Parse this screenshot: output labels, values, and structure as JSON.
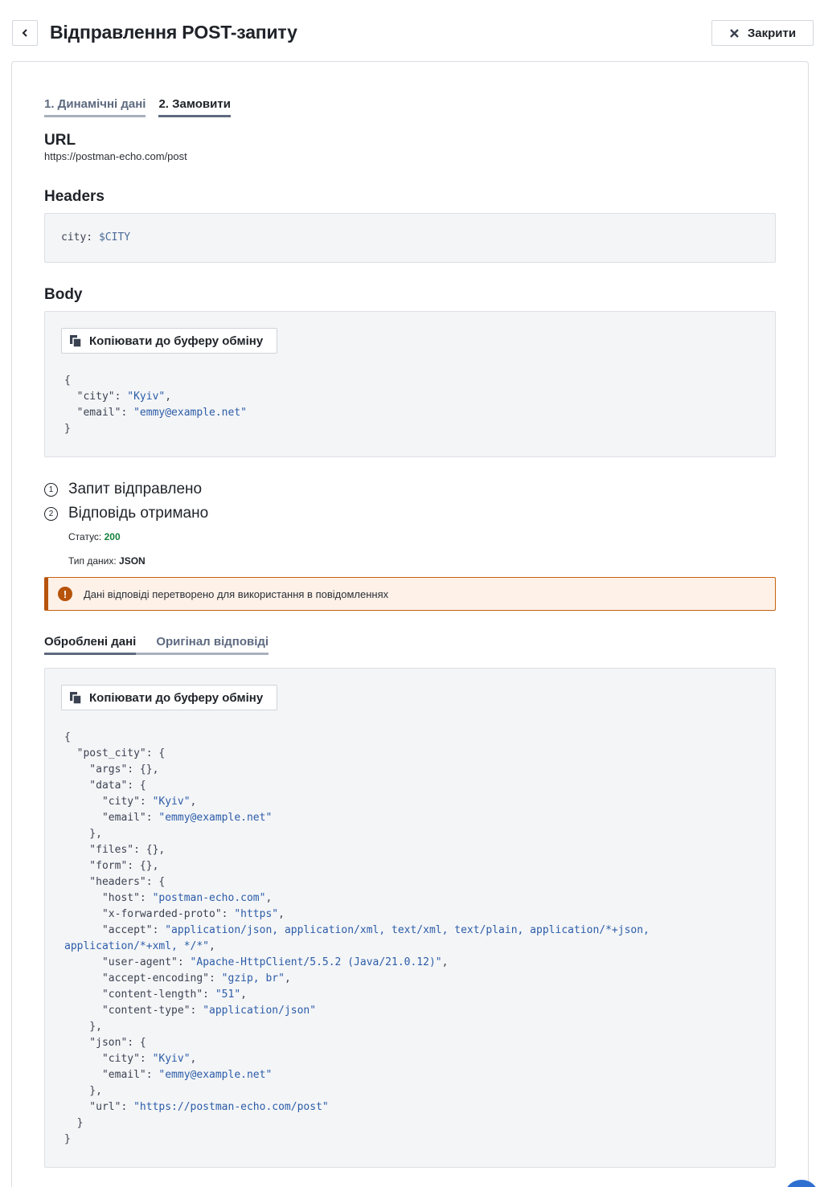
{
  "header": {
    "title": "Відправлення POST-запиту",
    "close_label": "Закрити"
  },
  "tabs": [
    {
      "label": "1. Динамічні дані",
      "active": false
    },
    {
      "label": "2. Замовити",
      "active": true
    }
  ],
  "url": {
    "heading": "URL",
    "value": "https://postman-echo.com/post"
  },
  "headers": {
    "heading": "Headers",
    "key": "city:",
    "value": "$CITY"
  },
  "body": {
    "heading": "Body",
    "copy_label": "Копіювати до буферу обміну",
    "lines": [
      [
        [
          "p",
          "{"
        ]
      ],
      [
        [
          "p",
          "  \"city\": "
        ],
        [
          "s",
          "\"Kyiv\""
        ],
        [
          "p",
          ","
        ]
      ],
      [
        [
          "p",
          "  \"email\": "
        ],
        [
          "s",
          "\"emmy@example.net\""
        ]
      ],
      [
        [
          "p",
          "}"
        ]
      ]
    ]
  },
  "steps": [
    {
      "num": "1",
      "label": "Запит відправлено"
    },
    {
      "num": "2",
      "label": "Відповідь отримано"
    }
  ],
  "response": {
    "status_label": "Статус:",
    "status_value": "200",
    "type_label": "Тип даних:",
    "type_value": "JSON",
    "alert_text": "Дані відповіді перетворено для використання в повідомленнях",
    "alert_icon": "!"
  },
  "result_tabs": [
    {
      "label": "Оброблені дані",
      "active": true
    },
    {
      "label": "Оригінал відповіді",
      "active": false
    }
  ],
  "result": {
    "copy_label": "Копіювати до буферу обміну",
    "lines": [
      [
        [
          "p",
          "{"
        ]
      ],
      [
        [
          "p",
          "  \"post_city\": {"
        ]
      ],
      [
        [
          "p",
          "    \"args\": {},"
        ]
      ],
      [
        [
          "p",
          "    \"data\": {"
        ]
      ],
      [
        [
          "p",
          "      \"city\": "
        ],
        [
          "s",
          "\"Kyiv\""
        ],
        [
          "p",
          ","
        ]
      ],
      [
        [
          "p",
          "      \"email\": "
        ],
        [
          "s",
          "\"emmy@example.net\""
        ]
      ],
      [
        [
          "p",
          "    },"
        ]
      ],
      [
        [
          "p",
          "    \"files\": {},"
        ]
      ],
      [
        [
          "p",
          "    \"form\": {},"
        ]
      ],
      [
        [
          "p",
          "    \"headers\": {"
        ]
      ],
      [
        [
          "p",
          "      \"host\": "
        ],
        [
          "s",
          "\"postman-echo.com\""
        ],
        [
          "p",
          ","
        ]
      ],
      [
        [
          "p",
          "      \"x-forwarded-proto\": "
        ],
        [
          "s",
          "\"https\""
        ],
        [
          "p",
          ","
        ]
      ],
      [
        [
          "p",
          "      \"accept\": "
        ],
        [
          "s",
          "\"application/json, application/xml, text/xml, text/plain, application/*+json,"
        ]
      ],
      [
        [
          "s",
          "application/*+xml, */*\""
        ],
        [
          "p",
          ","
        ]
      ],
      [
        [
          "p",
          "      \"user-agent\": "
        ],
        [
          "s",
          "\"Apache-HttpClient/5.5.2 (Java/21.0.12)\""
        ],
        [
          "p",
          ","
        ]
      ],
      [
        [
          "p",
          "      \"accept-encoding\": "
        ],
        [
          "s",
          "\"gzip, br\""
        ],
        [
          "p",
          ","
        ]
      ],
      [
        [
          "p",
          "      \"content-length\": "
        ],
        [
          "s",
          "\"51\""
        ],
        [
          "p",
          ","
        ]
      ],
      [
        [
          "p",
          "      \"content-type\": "
        ],
        [
          "s",
          "\"application/json\""
        ]
      ],
      [
        [
          "p",
          "    },"
        ]
      ],
      [
        [
          "p",
          "    \"json\": {"
        ]
      ],
      [
        [
          "p",
          "      \"city\": "
        ],
        [
          "s",
          "\"Kyiv\""
        ],
        [
          "p",
          ","
        ]
      ],
      [
        [
          "p",
          "      \"email\": "
        ],
        [
          "s",
          "\"emmy@example.net\""
        ]
      ],
      [
        [
          "p",
          "    },"
        ]
      ],
      [
        [
          "p",
          "    \"url\": "
        ],
        [
          "s",
          "\"https://postman-echo.com/post\""
        ]
      ],
      [
        [
          "p",
          "  }"
        ]
      ],
      [
        [
          "p",
          "}"
        ]
      ]
    ]
  },
  "colors": {
    "accent": "#5e6a80",
    "success": "#17803d",
    "warning": "#b7530a",
    "string": "#2b5ca8"
  }
}
